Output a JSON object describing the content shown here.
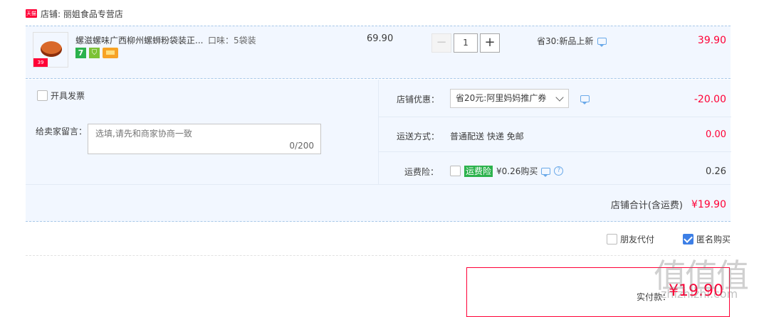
{
  "shop": {
    "icon": "tmall-icon",
    "icon_text": "天猫",
    "label": "店铺: 丽姐食品专营店"
  },
  "item": {
    "title": "螺滋螺味广西柳州螺蛳粉袋装正...",
    "sku": "口味：5袋装",
    "thumb_tag": "39",
    "price": "69.90",
    "qty": "1",
    "qty_minus": "−",
    "qty_plus": "+",
    "promo": "省30:新品上新",
    "subtotal": "39.90",
    "badge_seven": "7"
  },
  "invoice": {
    "label": "开具发票"
  },
  "message": {
    "label": "给卖家留言：",
    "placeholder": "选填,请先和商家协商一致",
    "count": "0/200"
  },
  "coupon": {
    "label": "店铺优惠：",
    "selected": "省20元:阿里妈妈推广券",
    "amount": "-20.00"
  },
  "shipping": {
    "label": "运送方式：",
    "value": "普通配送 快递 免邮",
    "amount": "0.00"
  },
  "insurance": {
    "label": "运费险：",
    "badge": "运费险",
    "price_text": "¥0.26购买",
    "amount": "0.26"
  },
  "total": {
    "label": "店铺合计(含运费)",
    "value": "¥19.90"
  },
  "options": {
    "friend_pay": "朋友代付",
    "anonymous": "匿名购买"
  },
  "pay": {
    "label": "实付款：",
    "value": "¥19.90"
  },
  "watermark": {
    "text": "值值值",
    "sub": "zhizhizhi.com"
  },
  "colors": {
    "accent": "#ff0036",
    "row_bg": "#f2f7ff",
    "check_blue": "#3d7fe6",
    "badge_green": "#2bb24c"
  }
}
